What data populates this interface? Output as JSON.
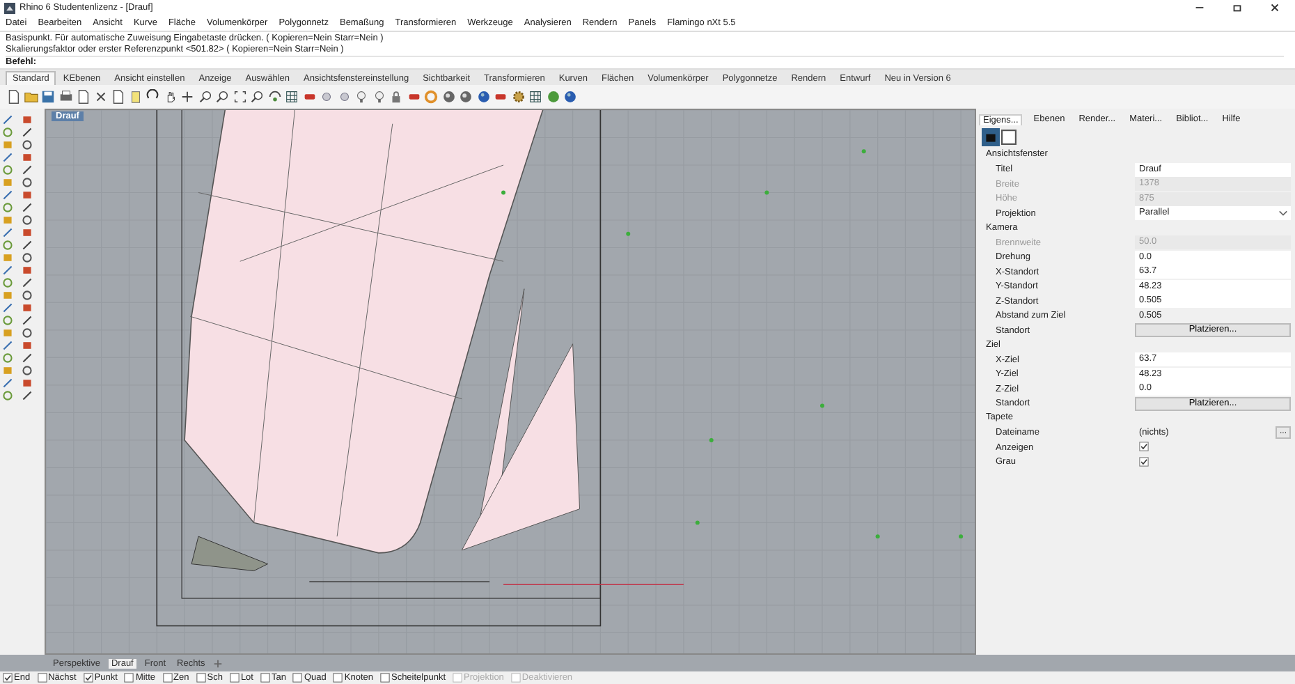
{
  "window": {
    "title": "Rhino 6 Studentenlizenz - [Drauf]"
  },
  "menu": [
    "Datei",
    "Bearbeiten",
    "Ansicht",
    "Kurve",
    "Fläche",
    "Volumenkörper",
    "Polygonnetz",
    "Bemaßung",
    "Transformieren",
    "Werkzeuge",
    "Analysieren",
    "Rendern",
    "Panels",
    "Flamingo nXt 5.5"
  ],
  "command": {
    "history": [
      "Basispunkt. Für automatische Zuweisung Eingabetaste drücken. ( Kopieren=Nein  Starr=Nein )",
      "Skalierungsfaktor oder erster Referenzpunkt <501.82> ( Kopieren=Nein  Starr=Nein )"
    ],
    "prompt": "Befehl:"
  },
  "toolbar_tabs": [
    {
      "label": "Standard",
      "selected": true
    },
    {
      "label": "KEbenen",
      "selected": false
    },
    {
      "label": "Ansicht einstellen",
      "selected": false
    },
    {
      "label": "Anzeige",
      "selected": false
    },
    {
      "label": "Auswählen",
      "selected": false
    },
    {
      "label": "Ansichtsfenstereinstellung",
      "selected": false
    },
    {
      "label": "Sichtbarkeit",
      "selected": false
    },
    {
      "label": "Transformieren",
      "selected": false
    },
    {
      "label": "Kurven",
      "selected": false
    },
    {
      "label": "Flächen",
      "selected": false
    },
    {
      "label": "Volumenkörper",
      "selected": false
    },
    {
      "label": "Polygonnetze",
      "selected": false
    },
    {
      "label": "Rendern",
      "selected": false
    },
    {
      "label": "Entwurf",
      "selected": false
    },
    {
      "label": "Neu in Version 6",
      "selected": false
    }
  ],
  "viewport": {
    "title": "Drauf"
  },
  "panel": {
    "tabs": [
      {
        "label": "Eigens...",
        "selected": true
      },
      {
        "label": "Ebenen",
        "selected": false
      },
      {
        "label": "Render...",
        "selected": false
      },
      {
        "label": "Materi...",
        "selected": false
      },
      {
        "label": "Bibliot...",
        "selected": false
      },
      {
        "label": "Hilfe",
        "selected": false
      }
    ],
    "sections": [
      {
        "title": "Ansichtsfenster",
        "rows": [
          {
            "kind": "text",
            "label": "Titel",
            "value": "Drauf"
          },
          {
            "kind": "readonly",
            "label": "Breite",
            "value": "1378"
          },
          {
            "kind": "readonly",
            "label": "Höhe",
            "value": "875"
          },
          {
            "kind": "dropdown",
            "label": "Projektion",
            "value": "Parallel"
          }
        ]
      },
      {
        "title": "Kamera",
        "rows": [
          {
            "kind": "readonly",
            "label": "Brennweite",
            "value": "50.0"
          },
          {
            "kind": "text",
            "label": "Drehung",
            "value": "0.0"
          },
          {
            "kind": "text",
            "label": "X-Standort",
            "value": "63.7"
          },
          {
            "kind": "text",
            "label": "Y-Standort",
            "value": "48.23"
          },
          {
            "kind": "text",
            "label": "Z-Standort",
            "value": "0.505"
          },
          {
            "kind": "plain",
            "label": "Abstand zum Ziel",
            "value": "0.505"
          },
          {
            "kind": "button",
            "label": "Standort",
            "value": "Platzieren..."
          }
        ]
      },
      {
        "title": "Ziel",
        "rows": [
          {
            "kind": "text",
            "label": "X-Ziel",
            "value": "63.7"
          },
          {
            "kind": "text",
            "label": "Y-Ziel",
            "value": "48.23"
          },
          {
            "kind": "text",
            "label": "Z-Ziel",
            "value": "0.0"
          },
          {
            "kind": "button",
            "label": "Standort",
            "value": "Platzieren..."
          }
        ]
      },
      {
        "title": "Tapete",
        "rows": [
          {
            "kind": "file",
            "label": "Dateiname",
            "value": "(nichts)",
            "button": "..."
          },
          {
            "kind": "checkbox",
            "label": "Anzeigen",
            "checked": true
          },
          {
            "kind": "checkbox",
            "label": "Grau",
            "checked": true
          }
        ]
      }
    ]
  },
  "viewport_tabs": [
    {
      "label": "Perspektive",
      "selected": false
    },
    {
      "label": "Drauf",
      "selected": true
    },
    {
      "label": "Front",
      "selected": false
    },
    {
      "label": "Rechts",
      "selected": false
    }
  ],
  "osnaps": [
    {
      "label": "End",
      "checked": true,
      "disabled": false
    },
    {
      "label": "Nächst",
      "checked": false,
      "disabled": false
    },
    {
      "label": "Punkt",
      "checked": true,
      "disabled": false
    },
    {
      "label": "Mitte",
      "checked": false,
      "disabled": false
    },
    {
      "label": "Zen",
      "checked": false,
      "disabled": false
    },
    {
      "label": "Sch",
      "checked": false,
      "disabled": false
    },
    {
      "label": "Lot",
      "checked": false,
      "disabled": false
    },
    {
      "label": "Tan",
      "checked": false,
      "disabled": false
    },
    {
      "label": "Quad",
      "checked": false,
      "disabled": false
    },
    {
      "label": "Knoten",
      "checked": false,
      "disabled": false
    },
    {
      "label": "Scheitelpunkt",
      "checked": false,
      "disabled": false
    },
    {
      "label": "Projektion",
      "checked": false,
      "disabled": true
    },
    {
      "label": "Deaktivieren",
      "checked": false,
      "disabled": true
    }
  ]
}
